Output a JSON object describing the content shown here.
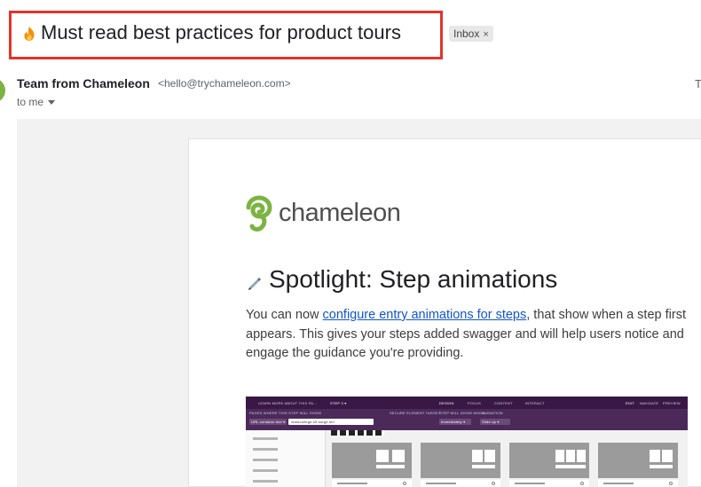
{
  "subject": {
    "title": "Must read best practices for product tours",
    "label": "Inbox",
    "label_close": "×"
  },
  "sender": {
    "name": "Team from Chameleon",
    "email": "<hello@trychameleon.com>",
    "to": "to me",
    "right_cut_text": "T"
  },
  "email_body": {
    "logo_text": "chameleon",
    "spotlight_title": "Spotlight: Step animations",
    "para_before": "You can now ",
    "link_text": "configure entry animations for steps",
    "para_after": ", that show when a step first appears. This gives your steps added swagger and will help users notice and engage the guidance you're providing."
  },
  "embedded_screenshot": {
    "top_left": "LEARN MORE ABOUT THIS PA...",
    "step": "STEP 3 ▾",
    "tab_design": "DESIGN",
    "tab_focus": "FOCUS",
    "tab_content": "CONTENT",
    "tab_interact": "INTERACT",
    "edit": "EDIT",
    "navigate": "NAVIGATE",
    "preview": "PREVIEW",
    "row_label_1": "PAGES WHERE THIS STEP WILL SHOW",
    "url_field": "URL contains text ▾",
    "url_value": "/samcollege.s9.surge.sh/",
    "row_label_2": "SECURE ELEMENT TARGET",
    "row_label_3": "STEP WILL SHOW WHEN",
    "row_label_4": "ANIMATION",
    "when_value": "Immediately ▾",
    "anim_value": "Slide up ▾"
  },
  "colors": {
    "highlight_border": "#e0352b",
    "link": "#1155cc",
    "logo_green": "#7cb342",
    "embedded_header": "#3a1846"
  },
  "icons": [
    "fire-icon",
    "caret-down-icon",
    "chameleon-logo-icon",
    "pen-icon"
  ]
}
